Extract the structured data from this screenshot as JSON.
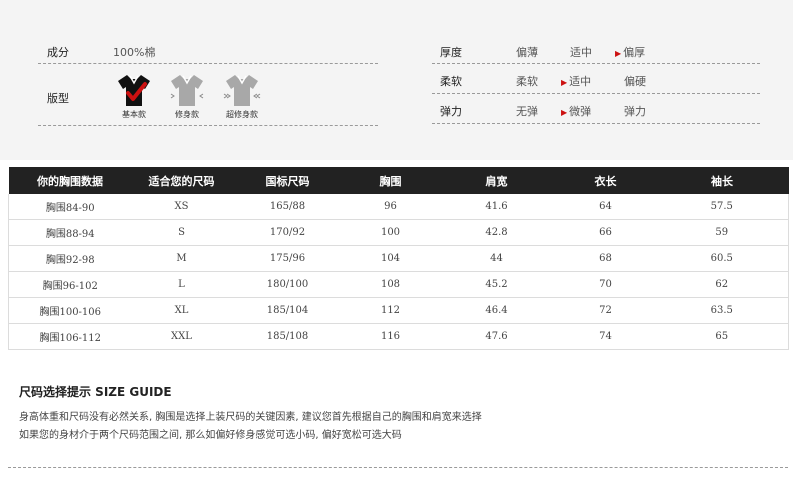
{
  "attributes": {
    "composition_label": "成分",
    "composition_value": "100%棉",
    "fit_label": "版型",
    "fit_options": [
      "基本款",
      "修身款",
      "超修身款"
    ],
    "fit_selected": "基本款"
  },
  "rating_rows": [
    {
      "label": "厚度",
      "options": [
        "偏薄",
        "适中",
        "偏厚"
      ],
      "selected": "偏厚"
    },
    {
      "label": "柔软",
      "options": [
        "柔软",
        "适中",
        "偏硬"
      ],
      "selected": "适中"
    },
    {
      "label": "弹力",
      "options": [
        "无弹",
        "微弹",
        "弹力"
      ],
      "selected": "微弹"
    }
  ],
  "size_table": {
    "headers": [
      "你的胸围数据",
      "适合您的尺码",
      "国标尺码",
      "胸围",
      "肩宽",
      "衣长",
      "袖长"
    ],
    "rows": [
      [
        "胸围84-90",
        "XS",
        "165/88",
        "96",
        "41.6",
        "64",
        "57.5"
      ],
      [
        "胸围88-94",
        "S",
        "170/92",
        "100",
        "42.8",
        "66",
        "59"
      ],
      [
        "胸围92-98",
        "M",
        "175/96",
        "104",
        "44",
        "68",
        "60.5"
      ],
      [
        "胸围96-102",
        "L",
        "180/100",
        "108",
        "45.2",
        "70",
        "62"
      ],
      [
        "胸围100-106",
        "XL",
        "185/104",
        "112",
        "46.4",
        "72",
        "63.5"
      ],
      [
        "胸围106-112",
        "XXL",
        "185/108",
        "116",
        "47.6",
        "74",
        "65"
      ]
    ]
  },
  "size_guide": {
    "title": "尺码选择提示 SIZE GUIDE",
    "lines": [
      "身高体重和尺码没有必然关系, 胸围是选择上装尺码的关键因素, 建议您首先根据自己的胸围和肩宽来选择",
      "如果您的身材介于两个尺码范围之间, 那么如偏好修身感觉可选小码, 偏好宽松可选大码"
    ]
  },
  "colors": {
    "accent": "#cc1111",
    "header_bg": "#222222",
    "panel_bg": "#f4f4f4",
    "shirt_selected": "#111111",
    "shirt_unselected": "#a8a8a8"
  }
}
